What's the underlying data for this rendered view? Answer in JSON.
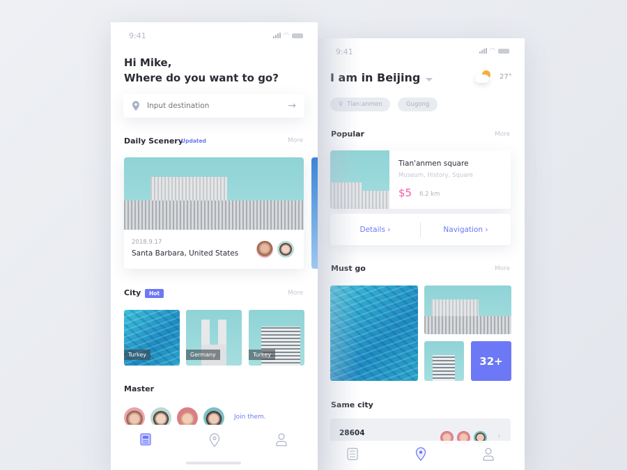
{
  "left_screen": {
    "status_time": "9:41",
    "greeting": "Hi Mike,",
    "question": "Where do you want to go?",
    "search": {
      "placeholder": "Input destination"
    },
    "daily_scenery": {
      "title": "Daily Scenery",
      "badge": "Updated",
      "more": "More",
      "card": {
        "date": "2018.9.17",
        "location": "Santa Barbara, United States"
      }
    },
    "city": {
      "title": "City",
      "badge": "Hot",
      "more": "More",
      "items": [
        {
          "label": "Turkey"
        },
        {
          "label": "Germany"
        },
        {
          "label": "Turkey"
        }
      ]
    },
    "master": {
      "title": "Master",
      "join": "Join them."
    },
    "nav": [
      "list-icon",
      "location-icon",
      "profile-icon"
    ],
    "active_nav": "list-icon"
  },
  "right_screen": {
    "status_time": "9:41",
    "location_title": "I am in Beijing",
    "weather": {
      "icon": "partly-cloudy-icon",
      "temp": "27°"
    },
    "chips": [
      {
        "label": "Tian:anmen"
      },
      {
        "label": "Gugong"
      }
    ],
    "popular": {
      "title": "Popular",
      "more": "More",
      "item": {
        "name": "Tian'anmen square",
        "tags": "Museum, History, Square",
        "price": "$5",
        "distance": "6.2 km"
      },
      "details": "Details",
      "navigation": "Navigation"
    },
    "must_go": {
      "title": "Must go",
      "more": "More",
      "count": "32+"
    },
    "same_city": {
      "title": "Same city",
      "count": "28604"
    },
    "active_nav": "location-icon"
  },
  "colors": {
    "accent": "#6c78f5",
    "price": "#f25ca6",
    "text": "#2a2c36",
    "muted": "#c3c7d1"
  }
}
